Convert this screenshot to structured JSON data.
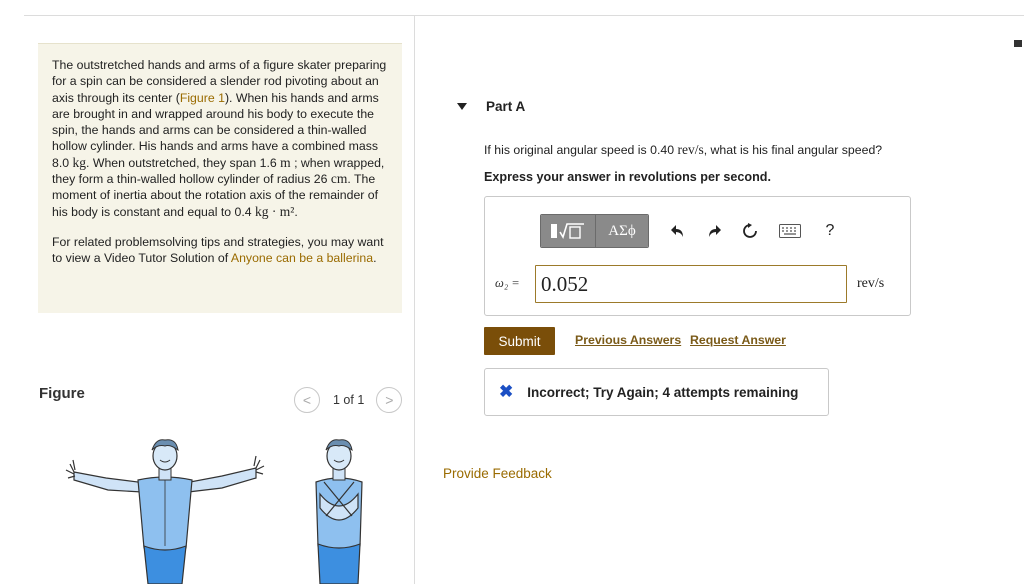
{
  "problem": {
    "p1_a": "The outstretched hands and arms of a figure skater preparing for a spin can be considered a slender rod pivoting about an axis through its center (",
    "figure_link": "Figure 1",
    "p1_b": "). When his hands and arms are brought in and wrapped around his body to execute the spin, the hands and arms can be considered a thin-walled hollow cylinder. His hands and arms have a combined mass 8.0 ",
    "unit_kg": "kg",
    "p1_c": ". When outstretched, they span 1.6 ",
    "unit_m": "m",
    "p1_d": " ; when wrapped, they form a thin-walled hollow cylinder of radius 26 ",
    "unit_cm": "cm",
    "p1_e": ". The moment of inertia about the rotation axis of the remainder of his body is constant and equal to 0.4 ",
    "unit_kgm2": "kg · m²",
    "p1_f": ".",
    "p2_a": "For related problemsolving tips and strategies, you may want to view a Video Tutor Solution of ",
    "video_link": "Anyone can be a ballerina",
    "p2_b": "."
  },
  "figure": {
    "label": "Figure",
    "prev": "<",
    "next": ">",
    "pager": "1 of 1"
  },
  "part": {
    "title": "Part A",
    "question_a": "If his original angular speed is 0.40 ",
    "question_unit": "rev/s",
    "question_b": ", what is his final angular speed?",
    "instruction": "Express your answer in revolutions per second."
  },
  "toolbar": {
    "symbols": "ΑΣϕ",
    "help": "?"
  },
  "answer": {
    "label": "ω₂ =",
    "value": "0.052",
    "unit": "rev/s"
  },
  "actions": {
    "submit": "Submit",
    "previous": "Previous Answers",
    "request": "Request Answer"
  },
  "feedback": {
    "icon": "✖",
    "text": "Incorrect; Try Again; 4 attempts remaining"
  },
  "provide_feedback": "Provide Feedback",
  "colors": {
    "accent_link": "#9a6b00",
    "submit_bg": "#7a4e09",
    "incorrect_icon": "#1b4fc4",
    "problem_bg": "#f6f4e8"
  }
}
